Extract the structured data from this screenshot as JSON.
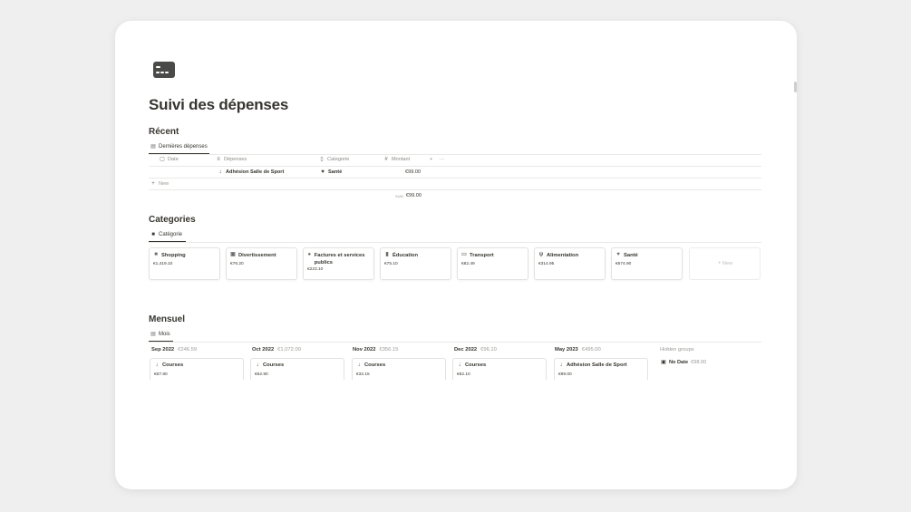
{
  "page": {
    "title": "Suivi des dépenses",
    "icon": "credit-card-icon"
  },
  "recent": {
    "heading": "Récent",
    "view_tab": "Dernières dépenses",
    "columns": [
      {
        "label": "Date",
        "icon": "calendar-icon"
      },
      {
        "label": "Dépenses",
        "icon": "text-icon"
      },
      {
        "label": "Categorie",
        "icon": "relation-icon"
      },
      {
        "label": "Montant",
        "icon": "hash-icon"
      }
    ],
    "add_column": "+",
    "more": "···",
    "rows": [
      {
        "date": "",
        "expense": "Adhésion Salle de Sport",
        "category": "Santé",
        "amount": "€99.00"
      }
    ],
    "new_label": "New",
    "sum_label": "SUM",
    "sum_value": "€99.00"
  },
  "categories": {
    "heading": "Categories",
    "view_tab": "Catégorie",
    "items": [
      {
        "name": "Shopping",
        "value": "€1,419.10",
        "icon": "shopping-bag-icon"
      },
      {
        "name": "Divertissement",
        "value": "€76.20",
        "icon": "film-icon"
      },
      {
        "name": "Factures et services publics",
        "value": "€223.10",
        "icon": "drop-icon"
      },
      {
        "name": "Éducation",
        "value": "€75.10",
        "icon": "book-icon"
      },
      {
        "name": "Transport",
        "value": "€82.49",
        "icon": "bus-icon"
      },
      {
        "name": "Alimentation",
        "value": "€314.95",
        "icon": "fork-knife-icon"
      },
      {
        "name": "Santé",
        "value": "€674.90",
        "icon": "heart-icon"
      }
    ],
    "new_label": "New"
  },
  "monthly": {
    "heading": "Mensuel",
    "view_tab": "Mois",
    "columns": [
      {
        "month": "Sep 2022",
        "total": "€246.59",
        "card_title": "Courses",
        "card_value": "€67.80"
      },
      {
        "month": "Oct 2022",
        "total": "€1,072.00",
        "card_title": "Courses",
        "card_value": "€62.90"
      },
      {
        "month": "Nov 2022",
        "total": "€356.15",
        "card_title": "Courses",
        "card_value": "€32.15"
      },
      {
        "month": "Dec 2022",
        "total": "€96.10",
        "card_title": "Courses",
        "card_value": "€52.10"
      },
      {
        "month": "May 2023",
        "total": "€495.00",
        "card_title": "Adhésion Salle de Sport",
        "card_value": "€99.00"
      }
    ],
    "hidden_groups_label": "Hidden groups",
    "hidden_groups": [
      {
        "name": "No Date",
        "value": "€98.00"
      }
    ]
  }
}
